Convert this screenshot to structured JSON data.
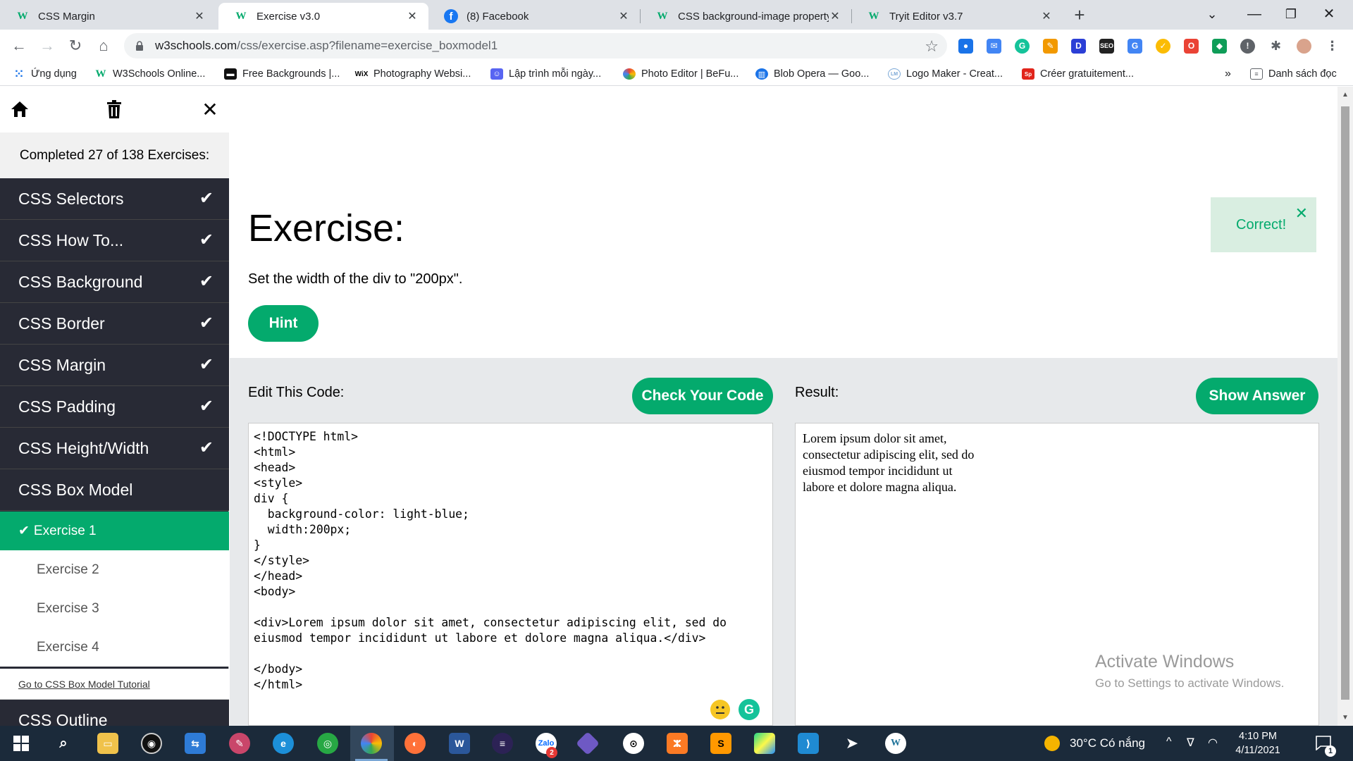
{
  "browser": {
    "tabs": [
      {
        "title": "CSS Margin",
        "favicon": "w3schools-icon"
      },
      {
        "title": "Exercise v3.0",
        "favicon": "w3schools-icon",
        "active": true
      },
      {
        "title": "(8) Facebook",
        "favicon": "facebook-icon"
      },
      {
        "title": "CSS background-image property",
        "favicon": "w3schools-icon"
      },
      {
        "title": "Tryit Editor v3.7",
        "favicon": "w3schools-icon"
      }
    ],
    "url_host": "w3schools.com",
    "url_path": "/css/exercise.asp?filename=exercise_boxmodel1",
    "bookmarks": [
      {
        "label": "Ứng dụng",
        "icon": "apps-grid-icon"
      },
      {
        "label": "W3Schools Online...",
        "icon": "w3schools-icon"
      },
      {
        "label": "Free Backgrounds |...",
        "icon": "backgrounds-icon"
      },
      {
        "label": "Photography Websi...",
        "icon": "wix-icon",
        "icon_text": "WiX"
      },
      {
        "label": "Lập trình mỗi ngày...",
        "icon": "discord-icon"
      },
      {
        "label": "Photo Editor | BeFu...",
        "icon": "befunky-icon"
      },
      {
        "label": "Blob Opera — Goo...",
        "icon": "arts-culture-icon"
      },
      {
        "label": "Logo Maker - Creat...",
        "icon": "logo-maker-icon"
      },
      {
        "label": "Créer gratuitement...",
        "icon": "spark-icon"
      }
    ],
    "bookmarks_overflow": "»",
    "reading_list": "Danh sách đọc"
  },
  "sidebar": {
    "progress": "Completed 27 of 138 Exercises:",
    "categories": [
      {
        "label": "CSS Selectors",
        "done": true
      },
      {
        "label": "CSS How To...",
        "done": true
      },
      {
        "label": "CSS Background",
        "done": true
      },
      {
        "label": "CSS Border",
        "done": true
      },
      {
        "label": "CSS Margin",
        "done": true
      },
      {
        "label": "CSS Padding",
        "done": true
      },
      {
        "label": "CSS Height/Width",
        "done": true
      },
      {
        "label": "CSS Box Model",
        "done": false
      }
    ],
    "exercises": [
      {
        "label": "Exercise 1",
        "active": true,
        "done": true
      },
      {
        "label": "Exercise 2"
      },
      {
        "label": "Exercise 3"
      },
      {
        "label": "Exercise 4"
      }
    ],
    "tutorial_link": "Go to CSS Box Model Tutorial",
    "next_category": "CSS Outline"
  },
  "exercise": {
    "title": "Exercise:",
    "instruction": "Set the width of the div to \"200px\".",
    "hint_label": "Hint",
    "correct_message": "Correct!",
    "edit_label": "Edit This Code:",
    "check_label": "Check Your Code",
    "result_label": "Result:",
    "answer_label": "Show Answer",
    "code": "<!DOCTYPE html>\n<html>\n<head>\n<style>\ndiv {\n  background-color: light-blue;\n  width:200px;\n}\n</style>\n</head>\n<body>\n\n<div>Lorem ipsum dolor sit amet, consectetur adipiscing elit, sed do eiusmod tempor incididunt ut labore et dolore magna aliqua.</div>\n\n</body>\n</html>",
    "result_text": "Lorem ipsum dolor sit amet, consectetur adipiscing elit, sed do eiusmod tempor incididunt ut labore et dolore magna aliqua."
  },
  "watermark": {
    "title": "Activate Windows",
    "subtitle": "Go to Settings to activate Windows."
  },
  "taskbar": {
    "weather": "30°C  Có nắng",
    "time": "4:10 PM",
    "date": "4/11/2021",
    "notification_count": "1",
    "zalo_badge": "2"
  },
  "colors": {
    "accent": "#04aa6d",
    "sidebar_bg": "#282a35",
    "work_area_bg": "#e7e9eb",
    "correct_bg": "#d9eee1"
  }
}
